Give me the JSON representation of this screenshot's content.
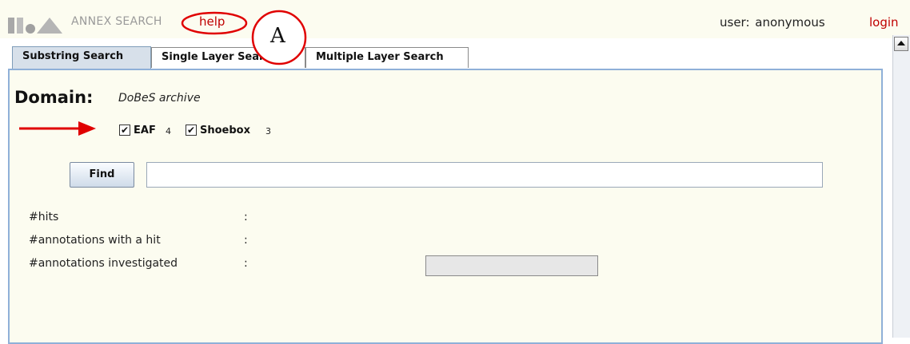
{
  "header": {
    "app_title": "ANNEX SEARCH",
    "help_label": "help",
    "user_text": "user:  anonymous",
    "login_label": "login"
  },
  "annotation": {
    "marker_letter": "A",
    "marker_color": "#e00000"
  },
  "tabs": [
    {
      "label": "Substring Search",
      "active": true
    },
    {
      "label": "Single Layer Search",
      "active": false
    },
    {
      "label": "Multiple Layer Search",
      "active": false
    }
  ],
  "domain": {
    "label": "Domain:",
    "value": "DoBeS archive"
  },
  "filters": [
    {
      "label": "EAF",
      "count": "4",
      "checked": true
    },
    {
      "label": "Shoebox",
      "count": "3",
      "checked": true
    }
  ],
  "search": {
    "find_label": "Find",
    "query_value": ""
  },
  "stats": [
    {
      "label": "#hits",
      "colon": ":"
    },
    {
      "label": "#annotations with a hit",
      "colon": ":"
    },
    {
      "label": "#annotations investigated",
      "colon": ":"
    }
  ],
  "colors": {
    "header_bg": "#fcfcf0",
    "link_red": "#c00000",
    "panel_border": "#8fb0d8",
    "active_tab_bg": "#d7e0ea"
  },
  "icons": {
    "logo": "annex-logo-icon",
    "checkbox_mark": "check-icon",
    "scroll_up": "arrow-up-icon",
    "pointer": "arrow-right-icon"
  }
}
